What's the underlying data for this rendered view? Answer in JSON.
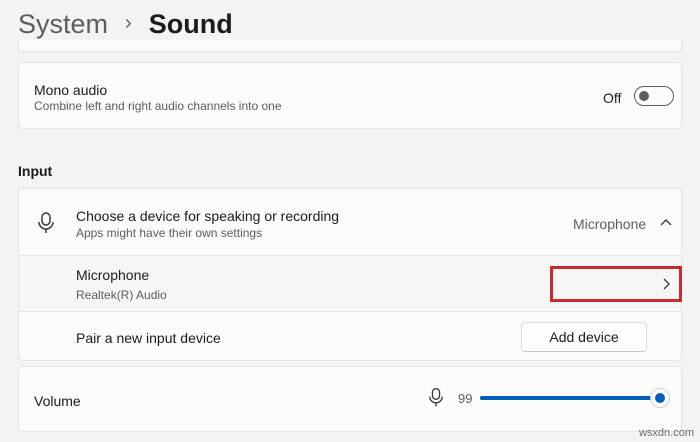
{
  "breadcrumb": {
    "parent": "System",
    "separator": "›",
    "current": "Sound"
  },
  "mono_audio": {
    "title": "Mono audio",
    "description": "Combine left and right audio channels into one",
    "state_label": "Off",
    "enabled": false
  },
  "input": {
    "section_title": "Input",
    "device_chooser": {
      "title": "Choose a device for speaking or recording",
      "description": "Apps might have their own settings",
      "selected_value": "Microphone",
      "icon": "microphone-icon",
      "expanded": true
    },
    "device": {
      "name": "Microphone",
      "driver": "Realtek(R) Audio",
      "action_icon": "chevron-right-icon"
    },
    "pair": {
      "label": "Pair a new input device",
      "button_label": "Add device"
    }
  },
  "volume": {
    "label": "Volume",
    "value_label": "99",
    "value": 99,
    "icon": "microphone-icon"
  },
  "watermark": "wsxdn.com",
  "colors": {
    "accent": "#005fb8",
    "highlight_box": "#cc2a33",
    "background": "#f3f3f3",
    "card": "#fbfbfb"
  }
}
